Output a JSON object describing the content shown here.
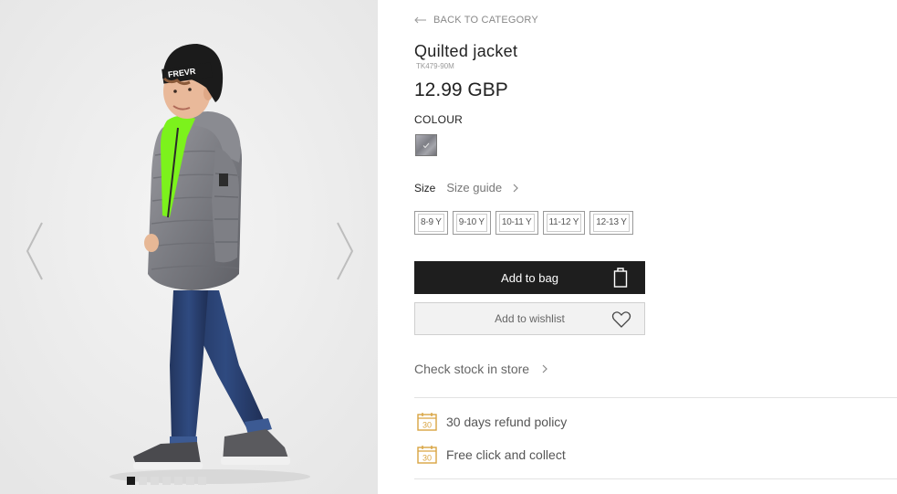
{
  "gallery": {
    "prev_icon": "chevron-left-icon",
    "next_icon": "chevron-right-icon",
    "image_count": 7,
    "active_index": 0,
    "beanie_text": "FREVR"
  },
  "product": {
    "back_label": "BACK TO CATEGORY",
    "title": "Quilted jacket",
    "sku": "TK479-90M",
    "price": "12.99 GBP",
    "colour_label": "COLOUR",
    "size_label": "Size",
    "size_guide_label": "Size guide",
    "sizes": [
      "8-9 Y",
      "9-10 Y",
      "10-11 Y",
      "11-12 Y",
      "12-13 Y"
    ],
    "add_to_bag_label": "Add to bag",
    "add_to_wishlist_label": "Add to wishlist",
    "check_stock_label": "Check stock in store"
  },
  "benefits": [
    {
      "icon": "calendar-30-icon",
      "label": "30 days refund policy",
      "icon_text": "30"
    },
    {
      "icon": "calendar-30-icon",
      "label": "Free click and collect",
      "icon_text": "30"
    }
  ],
  "colors": {
    "accent_icon": "#d9a441",
    "button_dark": "#1e1e1e"
  }
}
